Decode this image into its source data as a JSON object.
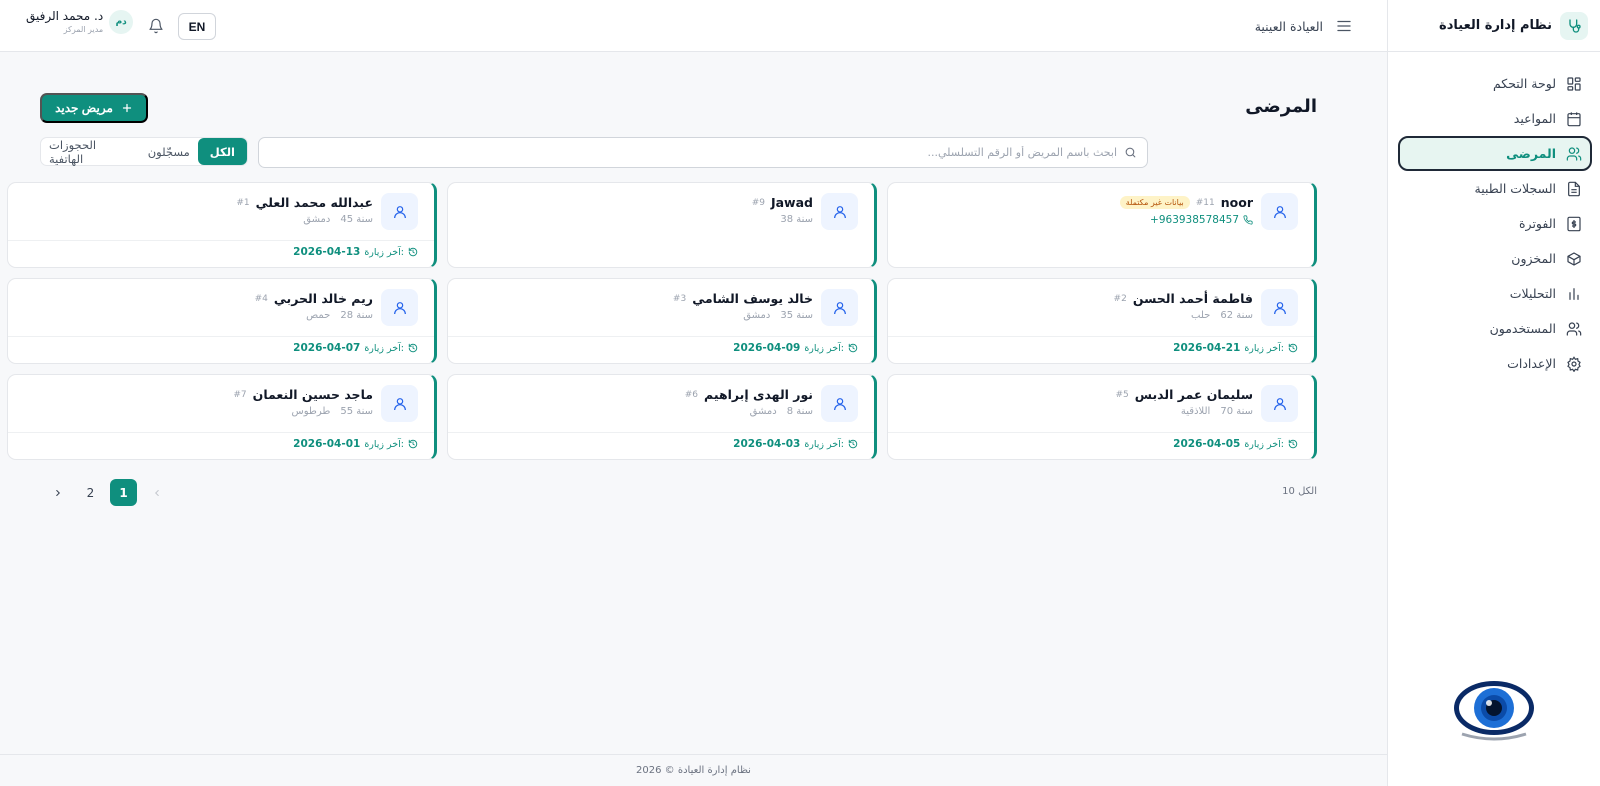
{
  "app": {
    "name": "نظام إدارة العيادة"
  },
  "header": {
    "title": "العيادة العينية",
    "language_button": "EN",
    "user": {
      "initials": "دم",
      "name": "د. محمد الرفيق",
      "role": "مدير المركز"
    }
  },
  "sidebar": {
    "items": [
      {
        "label": "لوحة التحكم",
        "icon": "dashboard-icon"
      },
      {
        "label": "المواعيد",
        "icon": "calendar-icon"
      },
      {
        "label": "المرضى",
        "icon": "users-icon",
        "active": true
      },
      {
        "label": "السجلات الطبية",
        "icon": "document-icon"
      },
      {
        "label": "الفوترة",
        "icon": "dollar-icon"
      },
      {
        "label": "المخزون",
        "icon": "box-icon"
      },
      {
        "label": "التحليلات",
        "icon": "chart-icon"
      },
      {
        "label": "المستخدمون",
        "icon": "users-icon"
      },
      {
        "label": "الإعدادات",
        "icon": "gear-icon"
      }
    ]
  },
  "page": {
    "title": "المرضى",
    "new_button": "مريض جديد",
    "search_placeholder": "ابحث باسم المريض أو الرقم التسلسلي...",
    "filters": [
      "الكل",
      "مسجّلون",
      "الحجوزات الهاتفية"
    ],
    "active_filter": "الكل",
    "last_visit_label": "آخر زيارة:"
  },
  "patients": [
    {
      "name": "noor",
      "id": "#11",
      "badge": "بيانات غير مكتملة",
      "phone": "+963938578457"
    },
    {
      "name": "Jawad",
      "id": "#9",
      "age": "38 سنة"
    },
    {
      "name": "عبدالله محمد العلي",
      "id": "#1",
      "age": "45 سنة",
      "city": "دمشق",
      "last_visit": "2026-04-13"
    },
    {
      "name": "فاطمة أحمد الحسن",
      "id": "#2",
      "age": "62 سنة",
      "city": "حلب",
      "last_visit": "2026-04-21"
    },
    {
      "name": "خالد يوسف الشامي",
      "id": "#3",
      "age": "35 سنة",
      "city": "دمشق",
      "last_visit": "2026-04-09"
    },
    {
      "name": "ريم خالد الحربي",
      "id": "#4",
      "age": "28 سنة",
      "city": "حمص",
      "last_visit": "2026-04-07"
    },
    {
      "name": "سليمان عمر الدبس",
      "id": "#5",
      "age": "70 سنة",
      "city": "اللاذقية",
      "last_visit": "2026-04-05"
    },
    {
      "name": "نور الهدى إبراهيم",
      "id": "#6",
      "age": "8 سنة",
      "city": "دمشق",
      "last_visit": "2026-04-03"
    },
    {
      "name": "ماجد حسين النعمان",
      "id": "#7",
      "age": "55 سنة",
      "city": "طرطوس",
      "last_visit": "2026-04-01"
    }
  ],
  "pagination": {
    "pages": [
      "1",
      "2"
    ],
    "current": "1",
    "total_label": "10 الكل"
  },
  "footer": {
    "text": "نظام إدارة العيادة © 2026"
  },
  "colors": {
    "primary": "#0f8f7e",
    "sidebar_active_bg": "#e7f5f1",
    "badge_bg": "#fef3c7"
  }
}
